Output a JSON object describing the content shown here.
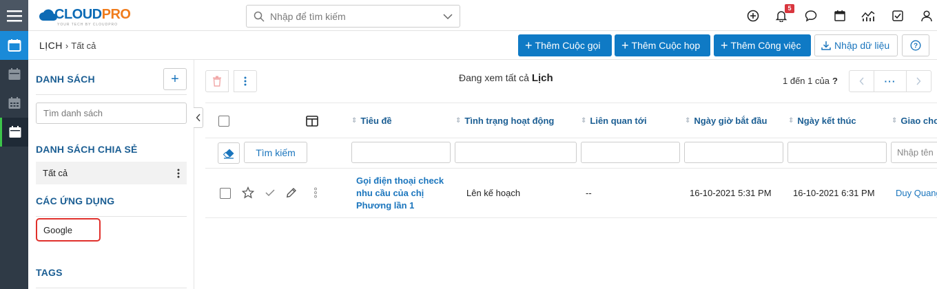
{
  "app": {
    "logo_main": "CLOUD",
    "logo_accent": "PRO",
    "logo_tagline": "YOUR TECH BY CLOUDPRO",
    "notification_count": "5"
  },
  "search": {
    "placeholder": "Nhập để tìm kiếm"
  },
  "breadcrumb": {
    "module": "LỊCH",
    "current": "Tất cả"
  },
  "actions": {
    "add_call": "Thêm Cuộc gọi",
    "add_meeting": "Thêm Cuộc họp",
    "add_task": "Thêm Công việc",
    "import": "Nhập dữ liệu"
  },
  "sidebar": {
    "list_title": "DANH SÁCH",
    "add_label": "+",
    "list_search_placeholder": "Tìm danh sách",
    "shared_title": "DANH SÁCH CHIA SẺ",
    "shared_items": [
      {
        "label": "Tất cả"
      }
    ],
    "apps_title": "CÁC ỨNG DỤNG",
    "apps_items": [
      {
        "label": "Google"
      }
    ],
    "tags_title": "TAGS"
  },
  "listview": {
    "viewing_prefix": "Đang xem tất cả",
    "viewing_module": "Lịch",
    "pagination": "1 đến 1 của",
    "pagination_help": "?",
    "pager_more": "···",
    "columns": [
      "Tiêu đề",
      "Tình trạng hoạt động",
      "Liên quan tới",
      "Ngày giờ bắt đầu",
      "Ngày kết thúc",
      "Giao cho"
    ],
    "search_button": "Tìm kiếm",
    "assignee_filter_placeholder": "Nhập tên",
    "rows": [
      {
        "title": "Gọi điện thoại check nhu cầu của chị Phương lần 1",
        "status": "Lên kế hoạch",
        "related": "--",
        "start": "16-10-2021 5:31 PM",
        "end": "16-10-2021 6:31 PM",
        "assignee": "Duy Quang"
      }
    ]
  },
  "colors": {
    "primary": "#0f7ac5",
    "heading": "#1b5e93",
    "rail_bg": "#2f3a46",
    "highlight": "#e0302b"
  }
}
